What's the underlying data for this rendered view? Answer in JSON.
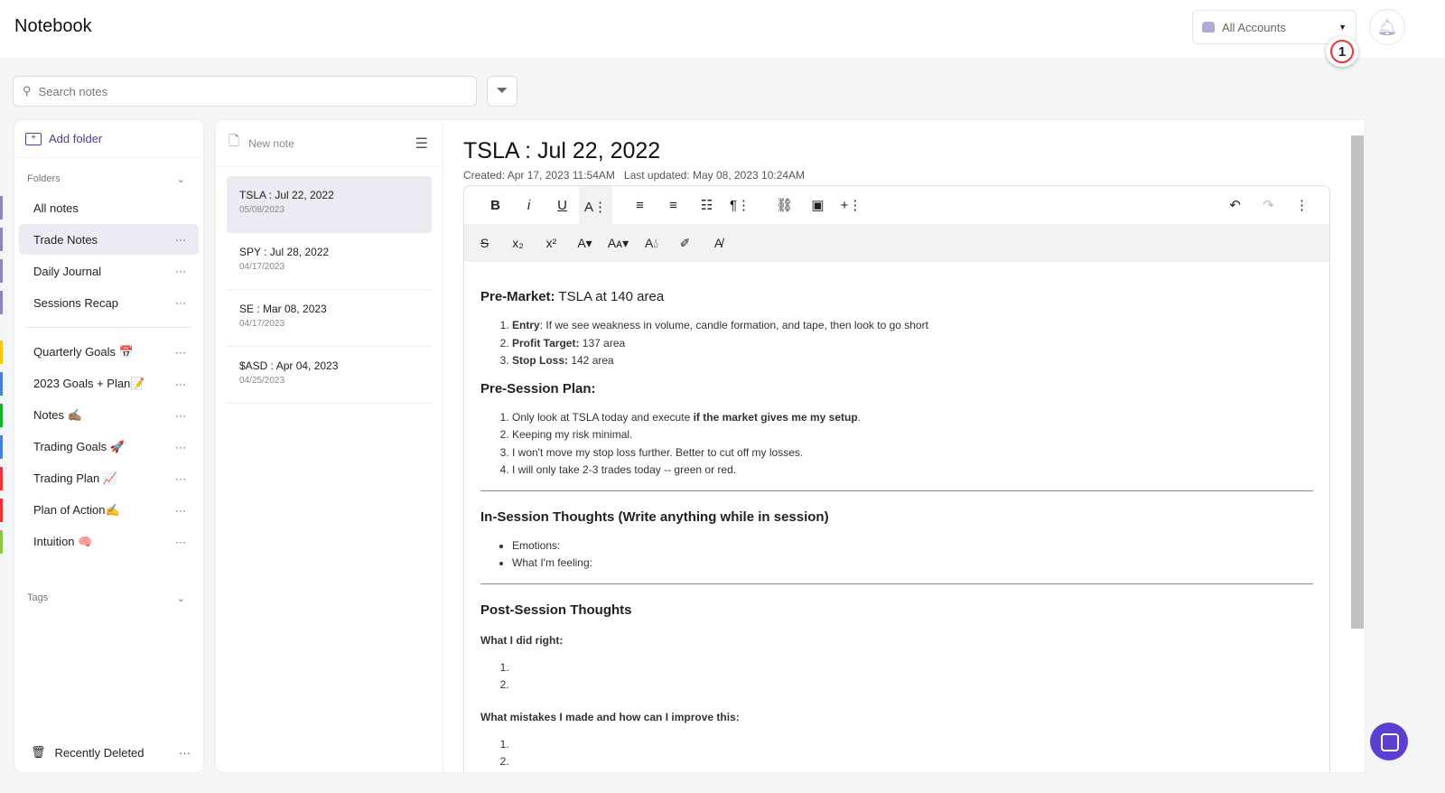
{
  "header": {
    "title": "Notebook",
    "account": "All Accounts",
    "badge": "1"
  },
  "search": {
    "placeholder": "Search notes"
  },
  "sidebar": {
    "add_folder": "Add folder",
    "folders_label": "Folders",
    "tags_label": "Tags",
    "recently_deleted": "Recently Deleted",
    "items": [
      {
        "label": "All notes",
        "color": "#8e85c0",
        "menu": false
      },
      {
        "label": "Trade Notes",
        "color": "#8e85c0",
        "menu": true,
        "active": true
      },
      {
        "label": "Daily Journal",
        "color": "#8e85c0",
        "menu": true
      },
      {
        "label": "Sessions Recap",
        "color": "#8e85c0",
        "menu": true
      },
      {
        "label": "Quarterly Goals 📅",
        "color": "#f2c811",
        "menu": true
      },
      {
        "label": "2023 Goals + Plan📝",
        "color": "#4a7fd6",
        "menu": true
      },
      {
        "label": "Notes ✍🏽",
        "color": "#17b02c",
        "menu": true
      },
      {
        "label": "Trading Goals 🚀",
        "color": "#4a7fd6",
        "menu": true
      },
      {
        "label": "Trading Plan 📈",
        "color": "#e8343a",
        "menu": true
      },
      {
        "label": "Plan of Action✍️",
        "color": "#e8343a",
        "menu": true
      },
      {
        "label": "Intuition 🧠",
        "color": "#8fc64a",
        "menu": true
      }
    ]
  },
  "notes_list": {
    "new_note": "New note",
    "items": [
      {
        "title": "TSLA : Jul 22, 2022",
        "date": "05/08/2023"
      },
      {
        "title": "SPY : Jul 28, 2022",
        "date": "04/17/2023"
      },
      {
        "title": "SE : Mar 08, 2023",
        "date": "04/17/2023"
      },
      {
        "title": "$ASD : Apr 04, 2023",
        "date": "04/25/2023"
      }
    ]
  },
  "editor": {
    "title": "TSLA : Jul 22, 2022",
    "created": "Created: Apr 17, 2023 11:54AM",
    "updated": "Last updated: May 08, 2023 10:24AM",
    "premarket_label": "Pre-Market:",
    "premarket_text": " TSLA at 140 area",
    "pm": [
      {
        "b": "Entry",
        "t": ": If we see weakness in volume, candle formation, and tape, then look to go short"
      },
      {
        "b": "Profit Target:",
        "t": " 137 area"
      },
      {
        "b": "Stop Loss:",
        "t": " 142 area"
      }
    ],
    "presession": "Pre-Session Plan:",
    "ps1a": "Only look at TSLA today and execute ",
    "ps1b": "if the market gives me my setup",
    "ps": [
      "Keeping my risk minimal.",
      "I won't move my stop loss further. Better to cut off my losses.",
      "I will only take 2-3 trades today -- green or red."
    ],
    "insession": "In-Session Thoughts (Write anything while in session)",
    "is": [
      "Emotions:",
      "What I'm feeling:"
    ],
    "postsession": "Post-Session Thoughts",
    "right": "What I did right:",
    "mistakes": "What mistakes I made and how can I improve this:"
  }
}
